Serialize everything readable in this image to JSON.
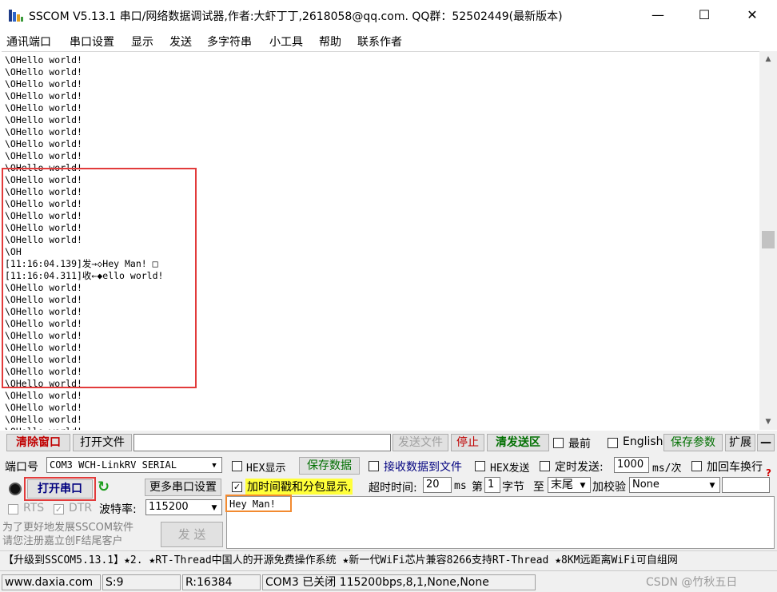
{
  "window": {
    "title": "SSCOM V5.13.1 串口/网络数据调试器,作者:大虾丁丁,2618058@qq.com. QQ群：52502449(最新版本)",
    "min": "—",
    "max": "☐",
    "close": "✕"
  },
  "menu": [
    "通讯端口",
    "串口设置",
    "显示",
    "发送",
    "多字符串",
    "小工具",
    "帮助",
    "联系作者"
  ],
  "receive": {
    "lines": [
      "\\OHello world!",
      "\\OHello world!",
      "\\OHello world!",
      "\\OHello world!",
      "\\OHello world!",
      "\\OHello world!",
      "\\OHello world!",
      "\\OHello world!",
      "\\OHello world!",
      "\\OHello world!",
      "\\OHello world!",
      "\\OHello world!",
      "\\OHello world!",
      "\\OHello world!",
      "\\OHello world!",
      "\\OHello world!",
      "\\OH",
      "[11:16:04.139]发→◇Hey Man! □",
      "[11:16:04.311]收←◆ello world!",
      "\\OHello world!",
      "\\OHello world!",
      "\\OHello world!",
      "\\OHello world!",
      "\\OHello world!",
      "\\OHello world!",
      "\\OHello world!",
      "\\OHello world!",
      "\\OHello world!",
      "\\OHello world!",
      "\\OHello world!",
      "\\OHello world!",
      "\\OHello world!"
    ]
  },
  "toolbar": {
    "clear_window": "清除窗口",
    "open_file": "打开文件",
    "send_file": "发送文件",
    "stop": "停止",
    "clear_send": "清发送区",
    "topmost": "最前",
    "english": "English",
    "save_params": "保存参数",
    "expand": "扩展",
    "collapse": "—"
  },
  "port": {
    "label": "端口号",
    "value": "COM3 WCH-LinkRV SERIAL",
    "open_button": "打开串口",
    "more_settings": "更多串口设置",
    "rts": "RTS",
    "dtr": "DTR",
    "baud_label": "波特率:",
    "baud_value": "115200"
  },
  "options": {
    "hex_display": "HEX显示",
    "save_data": "保存数据",
    "recv_to_file": "接收数据到文件",
    "hex_send": "HEX发送",
    "timed_send": "定时发送:",
    "timed_value": "1000",
    "timed_unit": "ms/次",
    "add_crlf": "加回车换行",
    "timestamp": "加时间戳和分包显示,",
    "timeout_label": "超时时间:",
    "timeout_value": "20",
    "timeout_unit": "ms",
    "byte_prefix": "第",
    "byte_index": "1",
    "byte_suffix": "字节",
    "to": "至",
    "end_value": "末尾",
    "checksum_label": "加校验",
    "checksum_value": "None"
  },
  "send": {
    "text": "Hey Man!",
    "button": "发  送",
    "promo_line1": "为了更好地发展SSCOM软件",
    "promo_line2": "请您注册嘉立创F结尾客户"
  },
  "promo_bar": "【升级到SSCOM5.13.1】★2. ★RT-Thread中国人的开源免费操作系统 ★新一代WiFi芯片兼容8266支持RT-Thread ★8KM远距离WiFi可自组网",
  "status": {
    "website": "www.daxia.com",
    "sent": "S:9",
    "received": "R:16384",
    "port_state": "COM3 已关闭  115200bps,8,1,None,None",
    "watermark": "CSDN @竹秋五日"
  }
}
